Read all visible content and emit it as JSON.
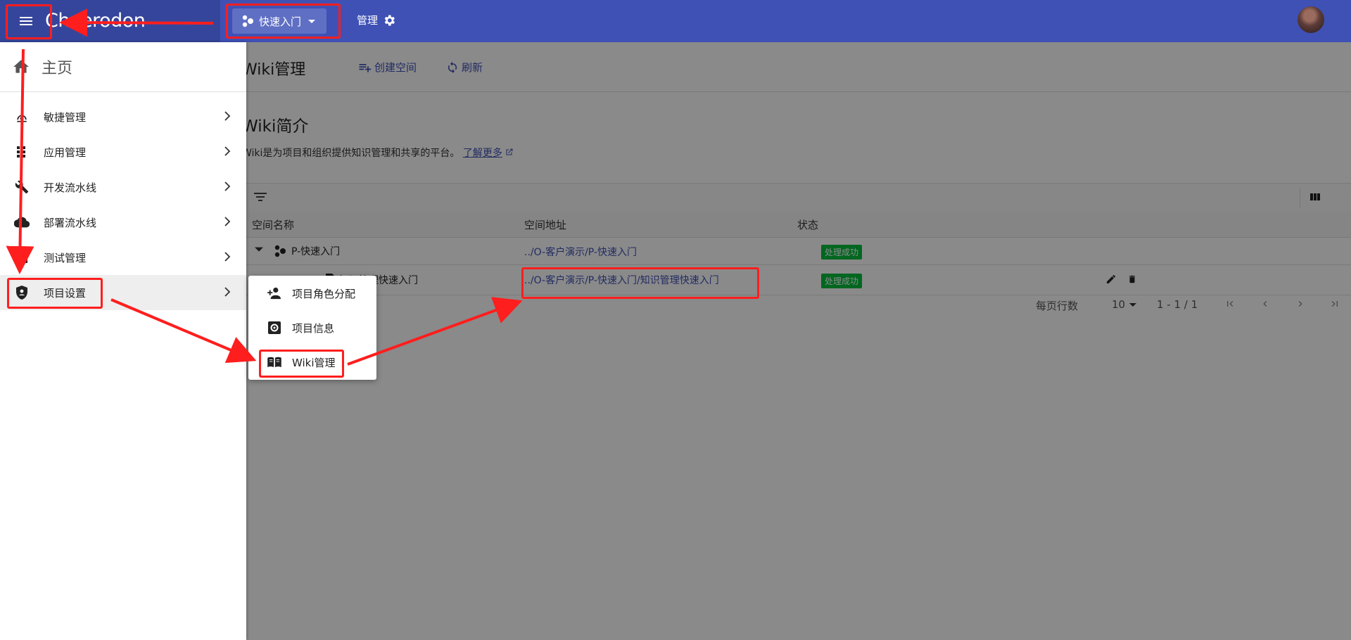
{
  "app": {
    "brand": "Choerodon"
  },
  "topbar": {
    "project_selector_label": "快速入门",
    "manage_label": "管理"
  },
  "page": {
    "title": "Wiki管理",
    "create_space": "创建空间",
    "refresh": "刷新"
  },
  "intro": {
    "title": "Wiki简介",
    "description": "Wiki是为项目和组织提供知识管理和共享的平台。",
    "learn_more": "了解更多"
  },
  "table": {
    "columns": [
      "空间名称",
      "空间地址",
      "状态"
    ],
    "rows": [
      {
        "name": "P-快速入门",
        "address": "../O-客户演示/P-快速入门",
        "status": "处理成功"
      },
      {
        "name": "知识管理快速入门",
        "address": "../O-客户演示/P-快速入门/知识管理快速入门",
        "status": "处理成功"
      }
    ]
  },
  "pager": {
    "rows_per_page_label": "每页行数",
    "rows_per_page": "10",
    "range": "1 - 1 / 1"
  },
  "sidenav": {
    "home": "主页",
    "items": [
      {
        "label": "敏捷管理",
        "icon": "agile-icon"
      },
      {
        "label": "应用管理",
        "icon": "apps-icon"
      },
      {
        "label": "开发流水线",
        "icon": "wrench-icon"
      },
      {
        "label": "部署流水线",
        "icon": "cloud-icon"
      },
      {
        "label": "测试管理",
        "icon": "test-icon"
      },
      {
        "label": "项目设置",
        "icon": "shield-icon"
      }
    ]
  },
  "submenu": {
    "items": [
      {
        "label": "项目角色分配",
        "icon": "person-add-icon"
      },
      {
        "label": "项目信息",
        "icon": "settings-box-icon"
      },
      {
        "label": "Wiki管理",
        "icon": "book-icon"
      }
    ]
  },
  "colors": {
    "primary": "#3F51B5",
    "success": "#00BF3C",
    "annotation": "#FF1E1E"
  }
}
